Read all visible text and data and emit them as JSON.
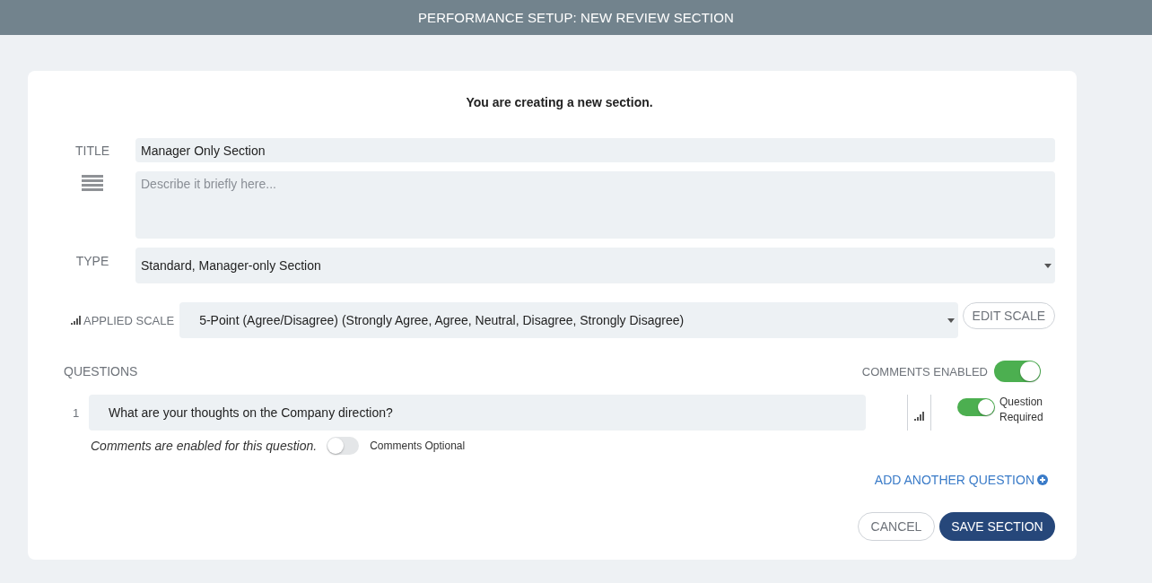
{
  "header": {
    "title": "PERFORMANCE SETUP: NEW REVIEW SECTION"
  },
  "form": {
    "intro": "You are creating a new section.",
    "title_field": {
      "label": "TITLE",
      "value": "Manager Only Section"
    },
    "description_field": {
      "placeholder": "Describe it briefly here..."
    },
    "type_field": {
      "label": "TYPE",
      "value": "Standard, Manager-only Section"
    },
    "scale_field": {
      "label": "APPLIED SCALE",
      "value": "5-Point (Agree/Disagree) (Strongly Agree, Agree, Neutral, Disagree, Strongly Disagree)",
      "button": "EDIT SCALE"
    }
  },
  "questions": {
    "label": "QUESTIONS",
    "comments_enabled": {
      "label": "COMMENTS ENABLED",
      "on": true
    },
    "items": [
      {
        "number": "1",
        "text": "What are your thoughts on the Company direction?",
        "required": {
          "label": "Question Required",
          "on": true
        },
        "comments": {
          "note": "Comments are enabled for this question.",
          "label": "Comments Optional",
          "on": false
        }
      }
    ],
    "add_button": "ADD ANOTHER QUESTION"
  },
  "actions": [
    {
      "label": "CANCEL",
      "kind": "secondary"
    },
    {
      "label": "SAVE SECTION",
      "kind": "primary"
    }
  ]
}
